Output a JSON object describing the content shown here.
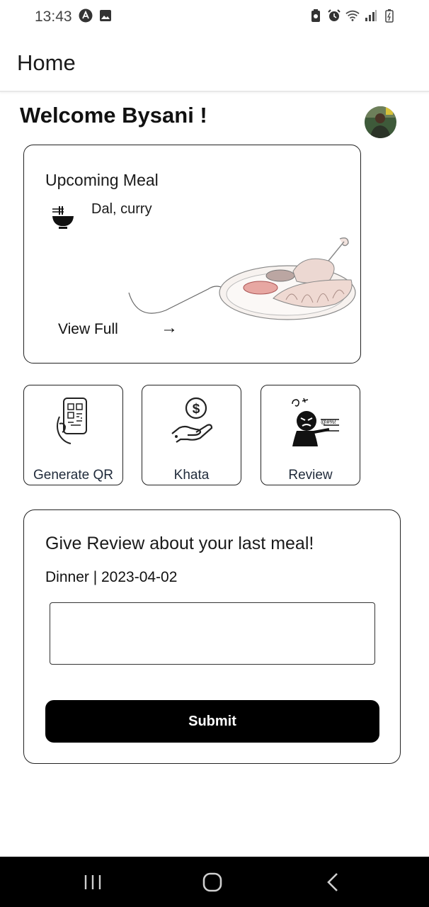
{
  "status_bar": {
    "time": "13:43",
    "left_icons": [
      "app-notification-icon",
      "image-notification-icon"
    ],
    "right_icons": [
      "battery-saver-icon",
      "alarm-icon",
      "wifi-icon",
      "signal-icon",
      "battery-icon"
    ]
  },
  "app_bar": {
    "title": "Home"
  },
  "welcome": {
    "text": "Welcome Bysani !"
  },
  "upcoming_meal": {
    "heading": "Upcoming Meal",
    "items": "Dal, curry",
    "view_full_label": "View Full",
    "arrow": "→"
  },
  "quick_actions": [
    {
      "label": "Generate QR",
      "icon": "phone-qr-icon"
    },
    {
      "label": "Khata",
      "icon": "hand-coin-icon"
    },
    {
      "label": "Review",
      "icon": "angry-review-icon"
    }
  ],
  "review_card": {
    "heading": "Give Review about your last meal!",
    "meal_info": "Dinner | 2023-04-02",
    "input_value": "",
    "submit_label": "Submit"
  },
  "nav_bar": {
    "items": [
      "recents-icon",
      "home-icon",
      "back-icon"
    ]
  },
  "colors": {
    "primary_button": "#000000",
    "nav_bar": "#000000",
    "border": "#222222",
    "background": "#ffffff"
  }
}
